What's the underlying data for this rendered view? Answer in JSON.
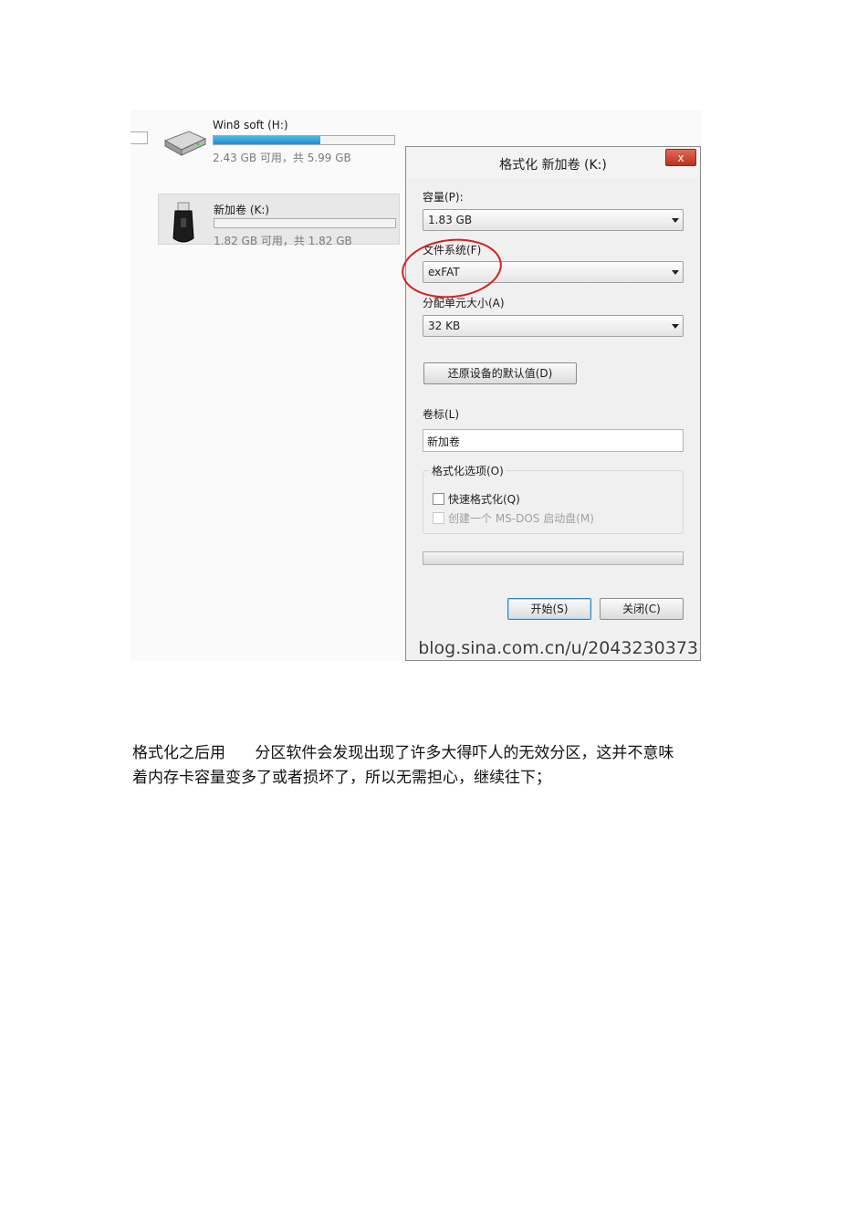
{
  "explorer": {
    "drives": [
      {
        "name": "Win8 soft (H:)",
        "info": "2.43 GB 可用，共 5.99 GB",
        "used_fraction": 0.59
      },
      {
        "name": "新加卷 (K:)",
        "info": "1.82 GB 可用，共 1.82 GB",
        "used_fraction": 0.0
      }
    ]
  },
  "dialog": {
    "title": "格式化 新加卷 (K:)",
    "close_label": "x",
    "capacity_label": "容量(P):",
    "capacity_value": "1.83 GB",
    "filesystem_label": "文件系统(F)",
    "filesystem_value": "exFAT",
    "allocation_label": "分配单元大小(A)",
    "allocation_value": "32 KB",
    "restore_defaults_label": "还原设备的默认值(D)",
    "volume_label_label": "卷标(L)",
    "volume_label_value": "新加卷",
    "format_options_label": "格式化选项(O)",
    "quick_format_label": "快速格式化(Q)",
    "msdos_label": "创建一个 MS-DOS 启动盘(M)",
    "start_label": "开始(S)",
    "close_button_label": "关闭(C)"
  },
  "watermark": "blog.sina.com.cn/u/2043230373",
  "paragraph": {
    "line1": "格式化之后用      分区软件会发现出现了许多大得吓人的无效分区，这并不意味",
    "line2": "着内存卡容量变多了或者损坏了，所以无需担心，继续往下；"
  },
  "colors": {
    "highlight_circle": "#d42020",
    "usage_bar": "#1f8fcf",
    "close_button": "#c0392b"
  }
}
